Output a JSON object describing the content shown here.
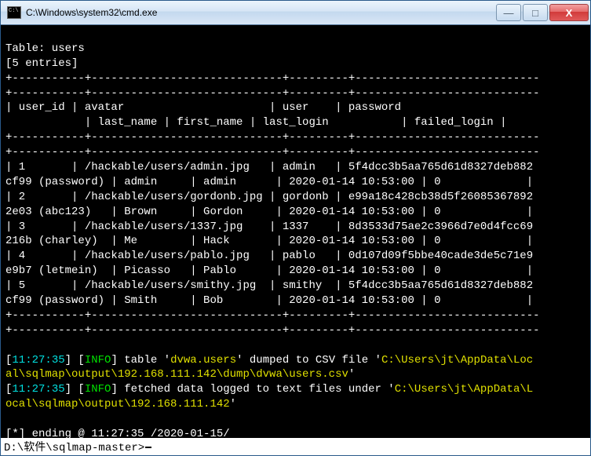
{
  "window": {
    "title": "C:\\Windows\\system32\\cmd.exe"
  },
  "header": {
    "table": "Table: users",
    "entries": "[5 entries]",
    "dash": "+-----------+-----------------------------+---------+----------------------------"
  },
  "cols": {
    "r1": "| user_id | avatar                      | user    | password                   ",
    "r2": "            | last_name | first_name | last_login           | failed_login |"
  },
  "rows": [
    "| 1       | /hackable/users/admin.jpg   | admin   | 5f4dcc3b5aa765d61d8327deb882",
    "cf99 (password) | admin     | admin      | 2020-01-14 10:53:00 | 0             |",
    "| 2       | /hackable/users/gordonb.jpg | gordonb | e99a18c428cb38d5f26085367892",
    "2e03 (abc123)   | Brown     | Gordon     | 2020-01-14 10:53:00 | 0             |",
    "| 3       | /hackable/users/1337.jpg    | 1337    | 8d3533d75ae2c3966d7e0d4fcc69",
    "216b (charley)  | Me        | Hack       | 2020-01-14 10:53:00 | 0             |",
    "| 4       | /hackable/users/pablo.jpg   | pablo   | 0d107d09f5bbe40cade3de5c71e9",
    "e9b7 (letmein)  | Picasso   | Pablo      | 2020-01-14 10:53:00 | 0             |",
    "| 5       | /hackable/users/smithy.jpg  | smithy  | 5f4dcc3b5aa765d61d8327deb882",
    "cf99 (password) | Smith     | Bob        | 2020-01-14 10:53:00 | 0             |"
  ],
  "log": {
    "t1": "11:27:35",
    "lvl": "INFO",
    "m1a": "] table '",
    "m1b": "dvwa.users",
    "m1c": "' dumped to CSV file '",
    "m1d": "C:\\Users\\jt\\AppData\\Loc",
    "m1e": "al\\sqlmap\\output\\192.168.111.142\\dump\\dvwa\\users.csv",
    "m2a": "] fetched data logged to text files under '",
    "m2b": "C:\\Users\\jt\\AppData\\L",
    "m2c": "ocal\\sqlmap\\output\\192.168.111.142",
    "end": "[*] ending @ 11:27:35 /2020-01-15/"
  },
  "prompt": "D:\\软件\\sqlmap-master>"
}
